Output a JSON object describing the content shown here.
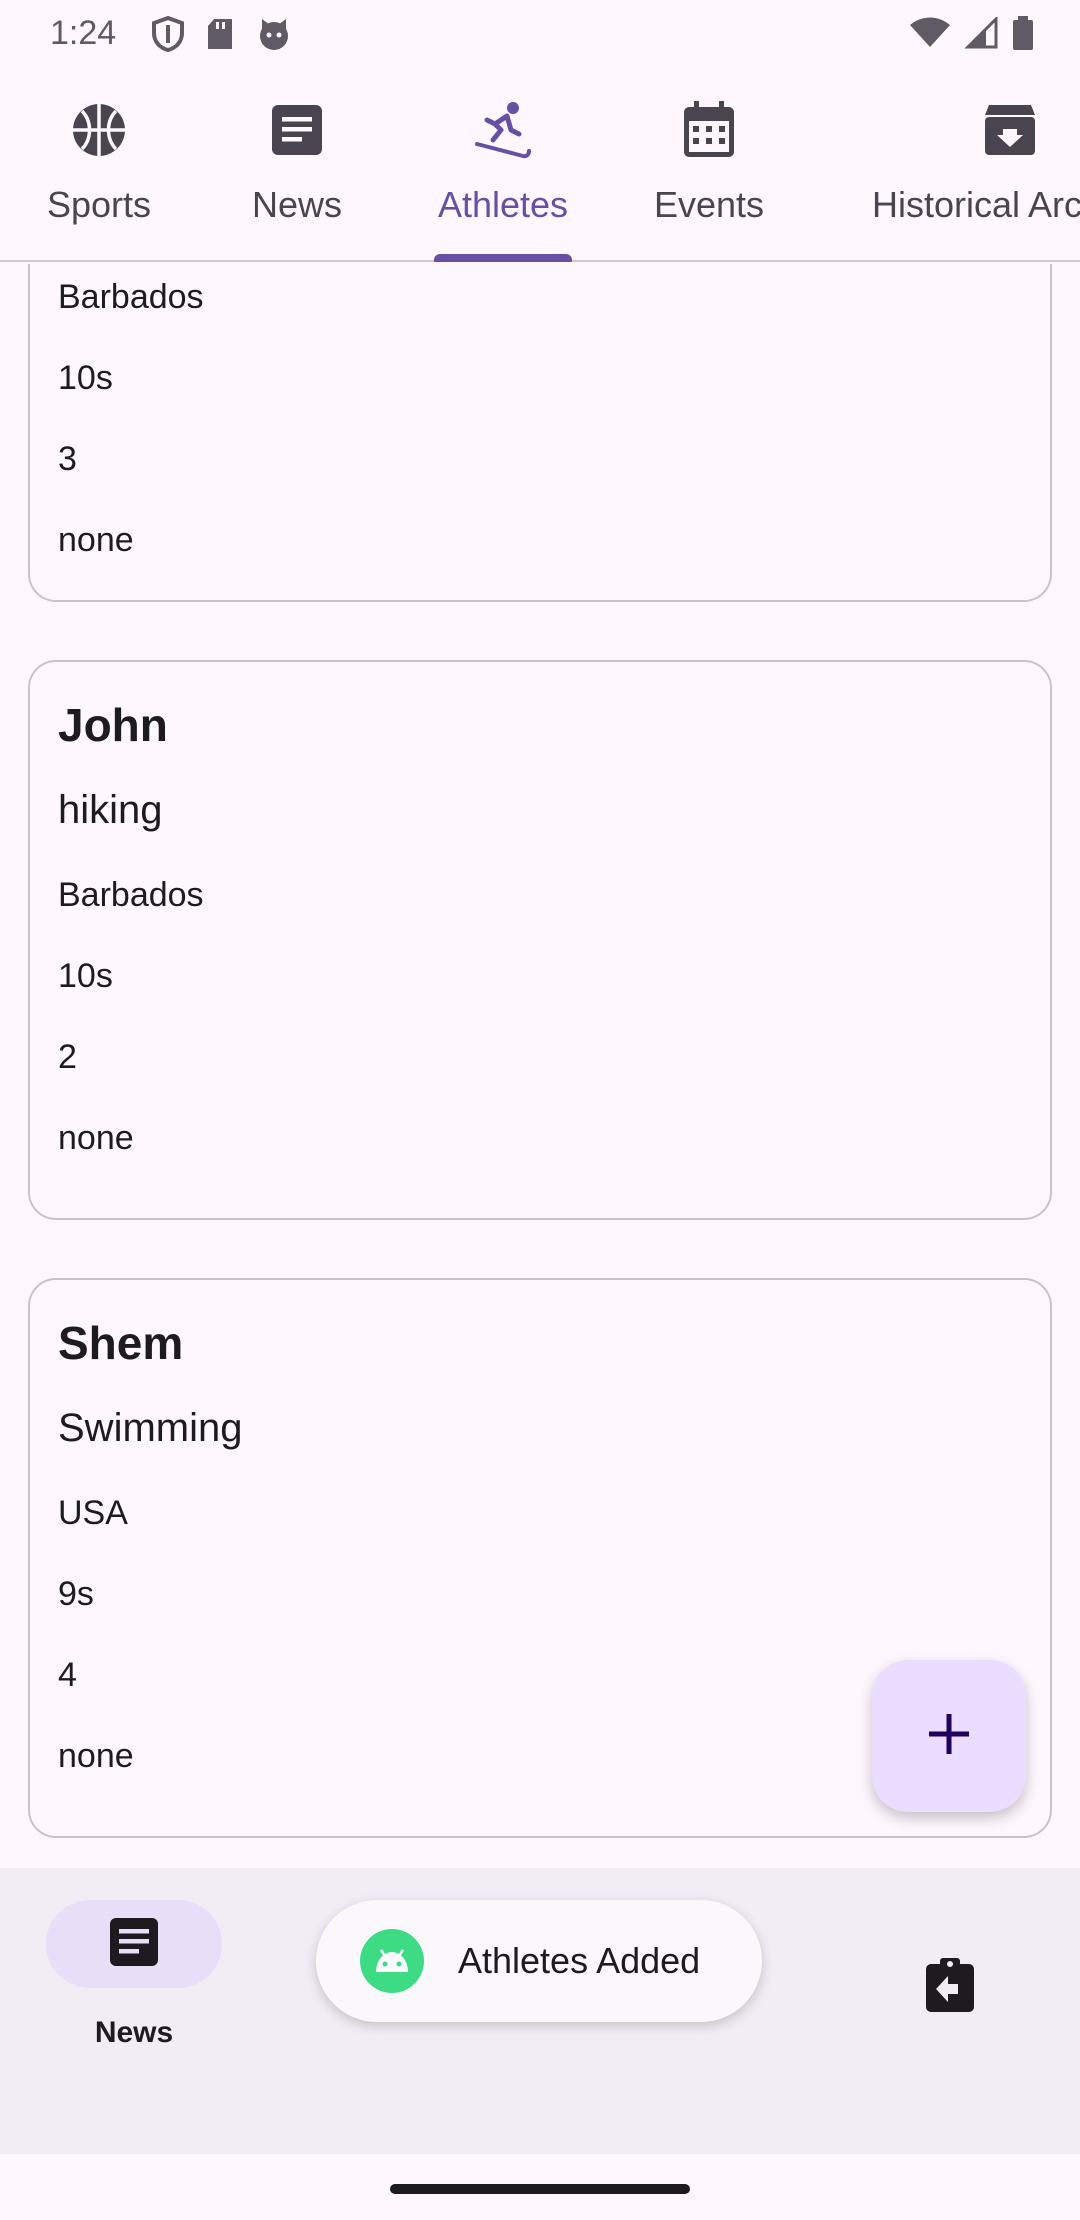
{
  "status_bar": {
    "time": "1:24"
  },
  "top_tabs": [
    {
      "label": "Sports",
      "icon": "basketball-icon"
    },
    {
      "label": "News",
      "icon": "article-icon"
    },
    {
      "label": "Athletes",
      "icon": "skiing-person-icon",
      "active": true
    },
    {
      "label": "Events",
      "icon": "calendar-icon"
    },
    {
      "label": "Historical Archive",
      "icon": "archive-icon"
    }
  ],
  "cards": [
    {
      "country": "Barbados",
      "time": "10s",
      "rank": "3",
      "notes": "none"
    },
    {
      "name": "John",
      "sport": "hiking",
      "country": "Barbados",
      "time": "10s",
      "rank": "2",
      "notes": "none"
    },
    {
      "name": "Shem",
      "sport": "Swimming",
      "country": "USA",
      "time": "9s",
      "rank": "4",
      "notes": "none"
    }
  ],
  "fab": {
    "icon": "plus-icon"
  },
  "bottom_nav": {
    "news_label": "News",
    "news_icon": "article-icon",
    "right_icon": "clipboard-arrow-icon"
  },
  "toast": {
    "text": "Athletes Added",
    "icon": "android-icon"
  },
  "colors": {
    "accent": "#6750a4",
    "surface": "#fef7fe",
    "nav_background": "#f2ecf4",
    "fab_background": "#eaddff",
    "nav_pill": "#e8def8"
  }
}
